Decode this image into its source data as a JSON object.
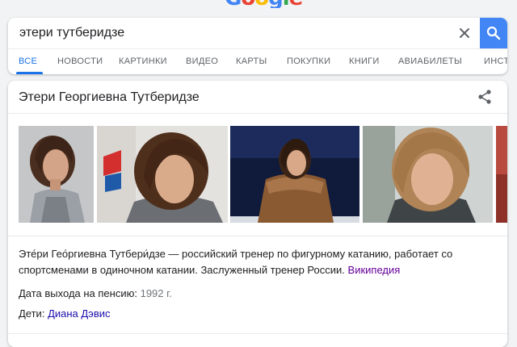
{
  "logo": {
    "letters": [
      "G",
      "o",
      "o",
      "g",
      "l",
      "e"
    ]
  },
  "search": {
    "query": "этери тутберидзе"
  },
  "tabs": [
    {
      "label": "ВСЕ"
    },
    {
      "label": "НОВОСТИ"
    },
    {
      "label": "КАРТИНКИ"
    },
    {
      "label": "ВИДЕО"
    },
    {
      "label": "КАРТЫ"
    },
    {
      "label": "ПОКУПКИ"
    },
    {
      "label": "КНИГИ"
    },
    {
      "label": "АВИАБИЛЕТЫ"
    },
    {
      "label": "ИНСТ"
    }
  ],
  "knowledge_panel": {
    "title": "Этери Георгиевна Тутберидзе",
    "description": "Эте́ри Гео́ргиевна Тутбери́дзе — российский тренер по фигурному катанию, работает со спортсменами в одиночном катании. Заслуженный тренер России.",
    "source_link": "Википедия",
    "facts": [
      {
        "label": "Дата выхода на пенсию:",
        "value": "1992 г."
      },
      {
        "label": "Дети:",
        "value": "Диана Дэвис"
      }
    ]
  },
  "colors": {
    "accent_blue": "#1a73e8",
    "search_button": "#4285f4",
    "visited_link": "#660099",
    "link": "#1a0dab"
  },
  "icons": [
    "clear-icon",
    "search-icon",
    "share-icon"
  ]
}
